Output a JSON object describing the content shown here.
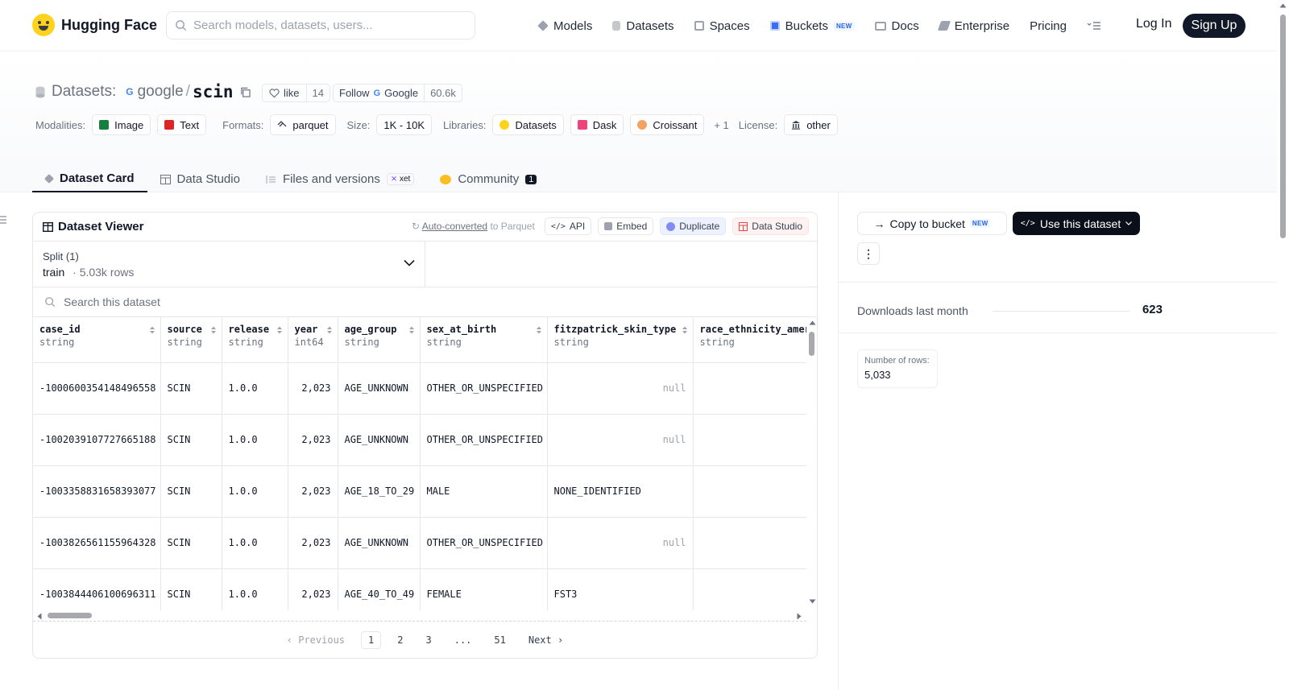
{
  "nav": {
    "brand": "Hugging Face",
    "search_placeholder": "Search models, datasets, users...",
    "links": [
      "Models",
      "Datasets",
      "Spaces",
      "Buckets",
      "Docs",
      "Enterprise",
      "Pricing"
    ],
    "buckets_badge": "NEW",
    "login": "Log In",
    "signup": "Sign Up"
  },
  "header": {
    "section": "Datasets:",
    "owner": "google",
    "name": "scin",
    "like_label": "like",
    "like_count": "14",
    "follow_label": "Follow",
    "follow_org": "Google",
    "follow_count": "60.6k"
  },
  "meta": {
    "modalities_label": "Modalities:",
    "modalities": [
      "Image",
      "Text"
    ],
    "formats_label": "Formats:",
    "format": "parquet",
    "size_label": "Size:",
    "size": "1K - 10K",
    "libraries_label": "Libraries:",
    "libraries": [
      "Datasets",
      "Dask",
      "Croissant"
    ],
    "libraries_more": "+ 1",
    "license_label": "License:",
    "license": "other"
  },
  "tabs": {
    "card": "Dataset Card",
    "studio": "Data Studio",
    "files": "Files and versions",
    "xet": "xet",
    "community": "Community",
    "community_count": "1"
  },
  "viewer": {
    "title": "Dataset Viewer",
    "auto_link": "Auto-converted",
    "auto_rest": "to Parquet",
    "api": "API",
    "embed": "Embed",
    "duplicate": "Duplicate",
    "data_studio": "Data Studio",
    "split_label": "Split (1)",
    "split_value": "train",
    "split_rows": "5.03k rows",
    "search_placeholder": "Search this dataset",
    "columns": [
      {
        "name": "case_id",
        "type": "string"
      },
      {
        "name": "source",
        "type": "string"
      },
      {
        "name": "release",
        "type": "string"
      },
      {
        "name": "year",
        "type": "int64"
      },
      {
        "name": "age_group",
        "type": "string"
      },
      {
        "name": "sex_at_birth",
        "type": "string"
      },
      {
        "name": "fitzpatrick_skin_type",
        "type": "string"
      },
      {
        "name": "race_ethnicity_amer",
        "type": "string"
      }
    ],
    "rows": [
      [
        "-1000600354148496558",
        "SCIN",
        "1.0.0",
        "2,023",
        "AGE_UNKNOWN",
        "OTHER_OR_UNSPECIFIED",
        "null",
        ""
      ],
      [
        "-1002039107727665188",
        "SCIN",
        "1.0.0",
        "2,023",
        "AGE_UNKNOWN",
        "OTHER_OR_UNSPECIFIED",
        "null",
        ""
      ],
      [
        "-1003358831658393077",
        "SCIN",
        "1.0.0",
        "2,023",
        "AGE_18_TO_29",
        "MALE",
        "NONE_IDENTIFIED",
        ""
      ],
      [
        "-1003826561155964328",
        "SCIN",
        "1.0.0",
        "2,023",
        "AGE_UNKNOWN",
        "OTHER_OR_UNSPECIFIED",
        "null",
        ""
      ],
      [
        "-1003844406100696311",
        "SCIN",
        "1.0.0",
        "2,023",
        "AGE_40_TO_49",
        "FEMALE",
        "FST3",
        ""
      ]
    ],
    "pager": {
      "previous": "Previous",
      "pages": [
        "1",
        "2",
        "3",
        "...",
        "51"
      ],
      "next": "Next"
    }
  },
  "sidebar": {
    "copy_bucket": "Copy to bucket",
    "copy_badge": "NEW",
    "use_dataset": "Use this dataset",
    "downloads_label": "Downloads last month",
    "downloads_value": "623",
    "rows_label": "Number of rows:",
    "rows_value": "5,033"
  },
  "colors": {
    "accent_dark": "#111827",
    "badge_blue": "#2563eb",
    "hf_yellow": "#ffd21e"
  }
}
